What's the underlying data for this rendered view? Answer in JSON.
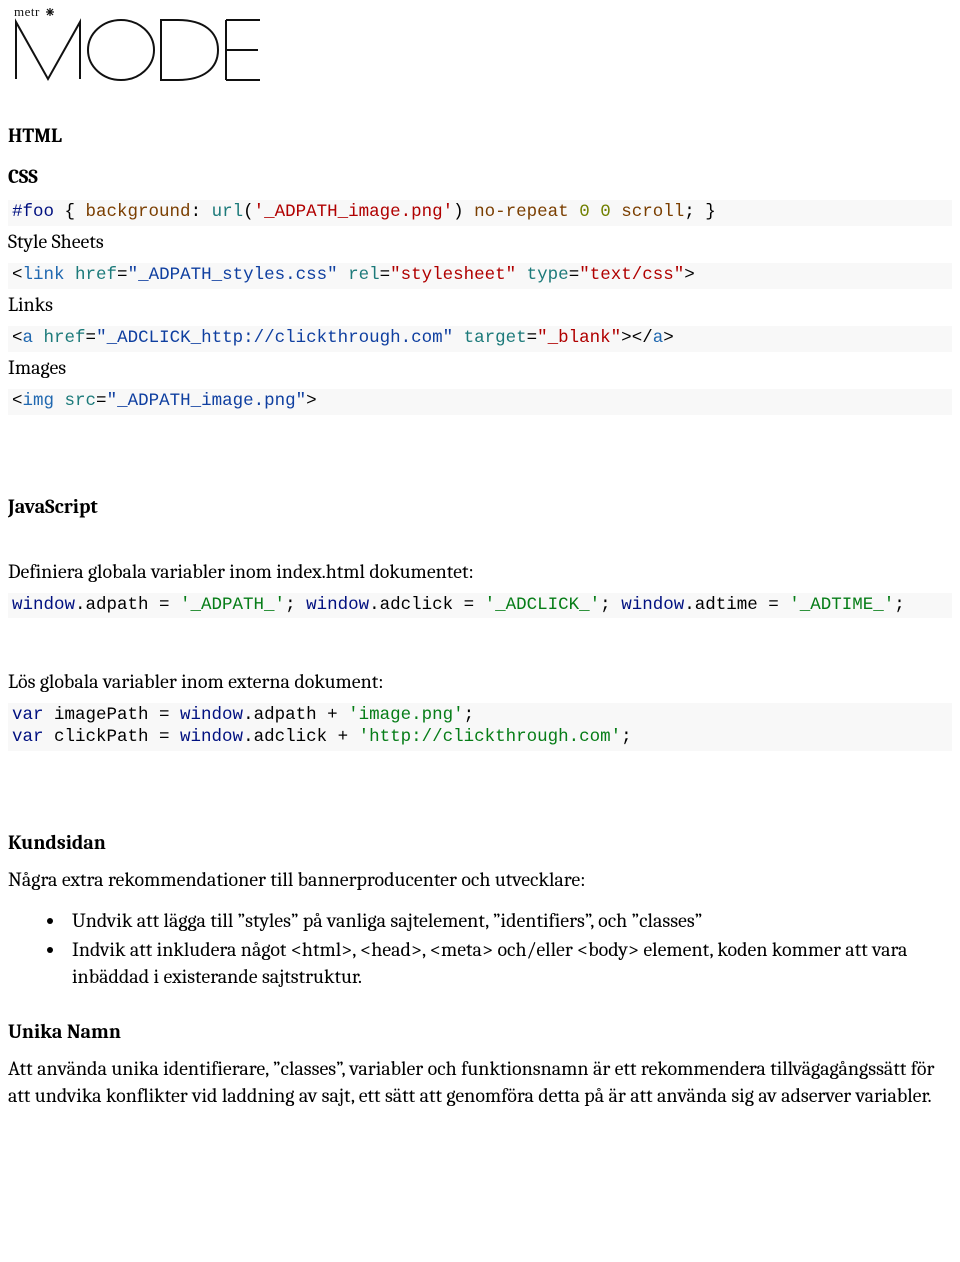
{
  "logo": {
    "top": "metr",
    "main_alt": "MODE"
  },
  "sections": {
    "html": "HTML",
    "css": "CSS",
    "style_sheets": "Style Sheets",
    "links": "Links",
    "images": "Images",
    "javascript": "JavaScript",
    "kundsidan": "Kundsidan",
    "unika": "Unika Namn"
  },
  "code": {
    "css_foo": {
      "sel": "#foo",
      "open": " { ",
      "prop": "background",
      "colon": ": ",
      "url_fn": "url",
      "url_open": "(",
      "url_str": "'_ADPATH_image.png'",
      "url_close": ") ",
      "kw1": "no-repeat",
      "sp1": " ",
      "n0a": "0",
      "sp2": " ",
      "n0b": "0",
      "sp3": " ",
      "kw2": "scroll",
      "end": "; }"
    },
    "link_tag": {
      "lt": "<",
      "tag": "link",
      "a1n": " href",
      "a1e": "=",
      "a1v": "\"_ADPATH_styles.css\"",
      "a2n": " rel",
      "a2e": "=",
      "a2v": "\"stylesheet\"",
      "a3n": " type",
      "a3e": "=",
      "a3v": "\"text/css\"",
      "gt": ">"
    },
    "a_tag": {
      "lt": "<",
      "tag": "a",
      "a1n": " href",
      "a1e": "=",
      "a1v": "\"_ADCLICK_http://clickthrough.com\"",
      "a2n": " target",
      "a2e": "=",
      "a2v": "\"_blank\"",
      "gt": ">",
      "lt2": "</",
      "tag2": "a",
      "gt2": ">"
    },
    "img_tag": {
      "lt": "<",
      "tag": "img",
      "a1n": " src",
      "a1e": "=",
      "a1v": "\"_ADPATH_image.png\"",
      "gt": ">"
    },
    "js_globals": {
      "p1a": "window",
      "p1b": ".adpath = ",
      "p1c": "'_ADPATH_'",
      "p1d": "; ",
      "p2a": "window",
      "p2b": ".adclick = ",
      "p2c": "'_ADCLICK_'",
      "p2d": "; ",
      "p3a": "window",
      "p3b": ".adtime = ",
      "p3c": "'_ADTIME_'",
      "p3d": ";"
    },
    "js_resolve": {
      "l1a": "var",
      "l1b": " imagePath = ",
      "l1c": "window",
      "l1d": ".adpath + ",
      "l1e": "'image.png'",
      "l1f": ";",
      "l2a": "var",
      "l2b": " clickPath = ",
      "l2c": "window",
      "l2d": ".adclick + ",
      "l2e": "'http://clickthrough.com'",
      "l2f": ";"
    }
  },
  "text": {
    "js_define": "Definiera globala variabler inom index.html dokumentet:",
    "js_resolve_cap": "Lös globala variabler inom externa dokument:",
    "kund_intro": "Några extra rekommendationer till bannerproducenter och utvecklare:",
    "bullet1": "Undvik att lägga till ”styles” på vanliga sajtelement, ”identifiers”, och ”classes”",
    "bullet2": "Indvik att inkludera något <html>, <head>, <meta> och/eller <body> element, koden kommer att vara inbäddad i existerande sajtstruktur.",
    "unika_para": "Att använda unika identifierare, ”classes”, variabler och funktionsnamn är ett rekommendera tillvägagångssätt för att undvika konflikter vid laddning av sajt, ett sätt att genomföra detta på är att använda sig av adserver variabler."
  }
}
